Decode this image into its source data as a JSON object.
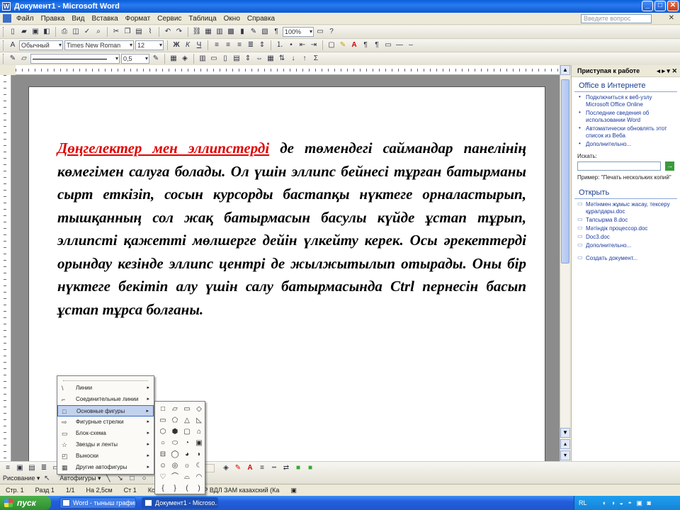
{
  "window": {
    "title": "Документ1 - Microsoft Word",
    "buttons": {
      "minimize": "_",
      "maximize": "□",
      "close": "✕"
    }
  },
  "menubar": {
    "items": [
      "Файл",
      "Правка",
      "Вид",
      "Вставка",
      "Формат",
      "Сервис",
      "Таблица",
      "Окно",
      "Справка"
    ],
    "ask_placeholder": "Введите вопрос",
    "close_glyph": "✕"
  },
  "toolbar_standard": {
    "zoom": "100%"
  },
  "toolbar_formatting": {
    "style": "Обычный",
    "font": "Times New Roman",
    "size": "12",
    "line_weight": "0,5"
  },
  "document": {
    "highlight_text": "Дөңгелектер мен эллипстерді",
    "body_text": " де төмендегі саймандар панелінің көмегімен салуға болады. Ол үшін эллипс бейнесі тұрған батырманы сырт еткізіп, сосын курсорды бастапқы нүктеге орналастырып, тышқанның сол жақ батырмасын басулы күйде ұстап тұрып, эллипсті қажетті мөлшерге дейін үлкейту керек. Осы әрекеттерді орындау кезінде эллипс центрі де жылжытылып отырады. Оны бір нүктеге бекітіп алу үшін салу батырмасында Ctrl пернесін басып ұстап тұрса болғаны."
  },
  "taskpane": {
    "header": "Приступая к работе",
    "controls": "◂ ▸ ▾ ✕",
    "office_section": "Office в Интернете",
    "office_links": [
      "Подключиться к веб-узлу Microsoft Office Online",
      "Последние сведения об использовании Word",
      "Автоматически обновлять этот список из Веба",
      "Дополнительно..."
    ],
    "search_label": "Искать:",
    "search_go": "→",
    "example": "Пример: \"Печать нескольких копий\"",
    "open_section": "Открыть",
    "open_links": [
      "Мәтінмен жұмыс жасау, тексеру құралдары.doc",
      "Тапсырма 8.doc",
      "Мәтіндік процессор.doc",
      "Doc3.doc"
    ],
    "more_link": "Дополнительно...",
    "create_link": "Создать документ..."
  },
  "drawbar": {
    "draw_label": "Рисование ▾",
    "autoshapes_label": "Автофигуры ▾"
  },
  "autoshapes_menu": {
    "items": [
      {
        "label": "Линии",
        "icon": "\\"
      },
      {
        "label": "Соединительные линии",
        "icon": "⌐"
      },
      {
        "label": "Основные фигуры",
        "icon": "□"
      },
      {
        "label": "Фигурные стрелки",
        "icon": "⇨"
      },
      {
        "label": "Блок-схема",
        "icon": "▭"
      },
      {
        "label": "Звезды и ленты",
        "icon": "☆"
      },
      {
        "label": "Выноски",
        "icon": "◰"
      },
      {
        "label": "Другие автофигуры",
        "icon": "▦"
      }
    ],
    "selected_index": 2,
    "shapes": [
      "□",
      "▱",
      "▭",
      "◇",
      "▭",
      "⬠",
      "△",
      "◺",
      "⬡",
      "⬢",
      "▢",
      "⌂",
      "○",
      "⬭",
      "◔",
      "▣",
      "⊟",
      "◯",
      "◕",
      "◗",
      "☺",
      "◎",
      "☼",
      "☾",
      "♡",
      "⌒",
      "⌓",
      "◠",
      "{",
      "}",
      "(",
      ")"
    ]
  },
  "statusbar": {
    "page": "Стр. 1",
    "section": "Разд 1",
    "pages": "1/1",
    "position": "На 2,5см",
    "line": "Ст 1",
    "column": "Кол 1",
    "modes": "ЗАП  ИСПР  ВДЛ  ЗАМ  казахский (Ка"
  },
  "taskbar": {
    "start_label": "пуск",
    "tasks": [
      "Word - тыныш графика...",
      "Документ1 - Microso..."
    ],
    "tray_lang": "RL",
    "tray_icons": "◐ ◑ ◒ ◓ ▣ ◙"
  }
}
